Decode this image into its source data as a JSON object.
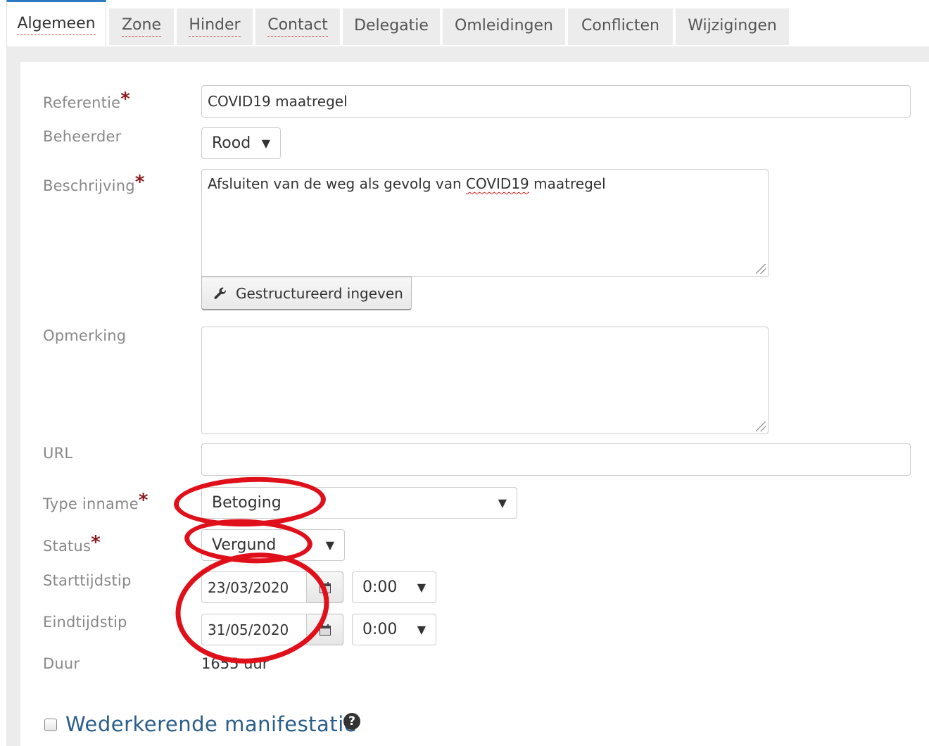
{
  "tabs": [
    {
      "label": "Algemeen",
      "active": true,
      "dotted": true
    },
    {
      "label": "Zone",
      "dotted": true
    },
    {
      "label": "Hinder",
      "dotted": true
    },
    {
      "label": "Contact",
      "dotted": true
    },
    {
      "label": "Delegatie"
    },
    {
      "label": "Omleidingen"
    },
    {
      "label": "Conflicten"
    },
    {
      "label": "Wijzigingen"
    }
  ],
  "form": {
    "referentie": {
      "label": "Referentie",
      "value": "COVID19 maatregel"
    },
    "beheerder": {
      "label": "Beheerder",
      "value": "Rood"
    },
    "beschrijving": {
      "label": "Beschrijving",
      "value_pre": "Afsluiten van de weg als gevolg van ",
      "value_mark": "COVID19",
      "value_post": " maatregel"
    },
    "structured_button": "Gestructureerd ingeven",
    "opmerking": {
      "label": "Opmerking",
      "value": ""
    },
    "url": {
      "label": "URL",
      "value": ""
    },
    "type_inname": {
      "label": "Type inname",
      "value": "Betoging"
    },
    "status": {
      "label": "Status",
      "value": "Vergund"
    },
    "starttijdstip": {
      "label": "Starttijdstip",
      "date": "23/03/2020",
      "time": "0:00"
    },
    "eindtijdstip": {
      "label": "Eindtijdstip",
      "date": "31/05/2020",
      "time": "0:00"
    },
    "duur": {
      "label": "Duur",
      "value": "1655 uur"
    }
  },
  "recurring": {
    "label": "Wederkerende manifestatie",
    "checked": false
  },
  "icons": {
    "wrench": "wrench-icon",
    "calendar": "calendar-icon",
    "help": "question-circle-icon"
  },
  "colors": {
    "accent": "#2c7bc0",
    "required": "#8b1a1a",
    "annotation": "#e0101a",
    "section_title": "#2a5d8a"
  }
}
